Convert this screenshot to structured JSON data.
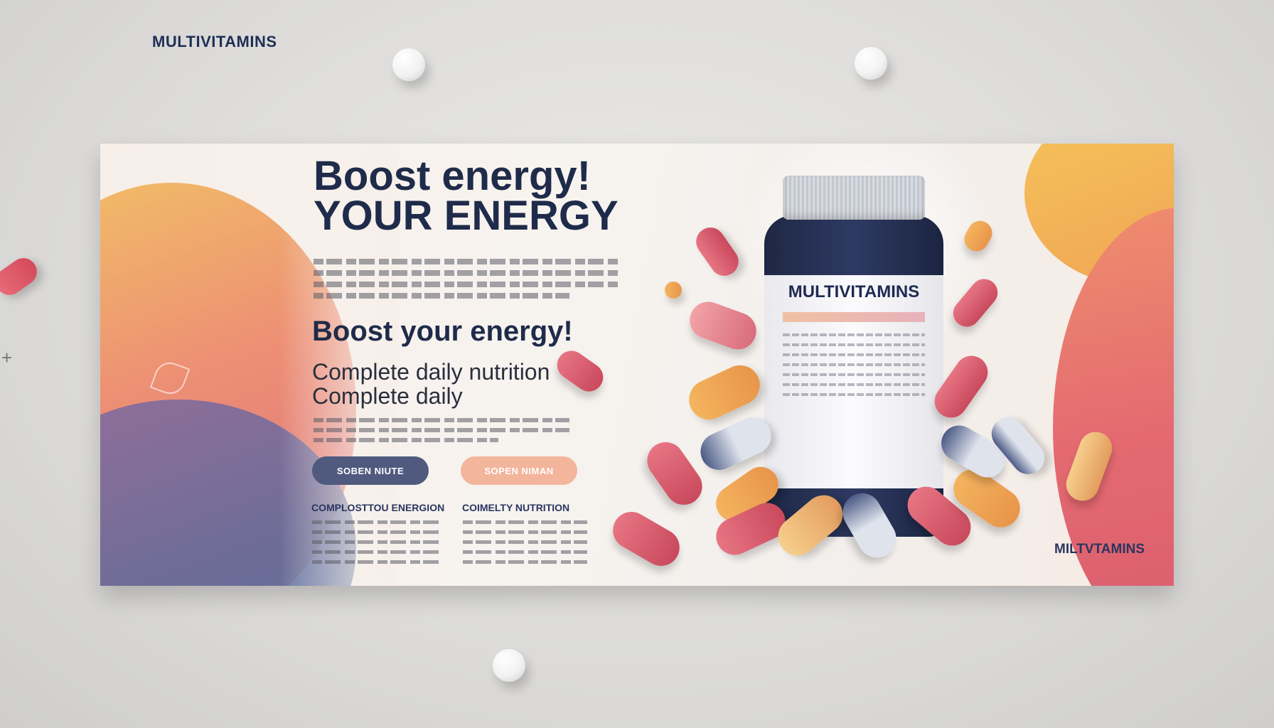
{
  "colors": {
    "navy": "#1f2b4a",
    "accent_pink": "#f3b59c",
    "button_dark": "#4f5a7e"
  },
  "top_brand": "MULTIVITAMINS",
  "banner": {
    "headline_line1": "Boost   energy!",
    "headline_line2": "YOUR ENERGY",
    "subheadline": "Boost your energy!",
    "tagline1": "Complete daily nutrition",
    "tagline2": "Complete daily",
    "button_primary": "SOBEN NIUTE",
    "button_secondary": "SOPEN NIMAN",
    "column1_heading": "COMPLOSTTOU ENERGION",
    "column2_heading": "COIMELTY NUTRITION",
    "bottle_label": "MULTIVITAMINS",
    "bottom_brand": "MILTVTAMINS"
  }
}
